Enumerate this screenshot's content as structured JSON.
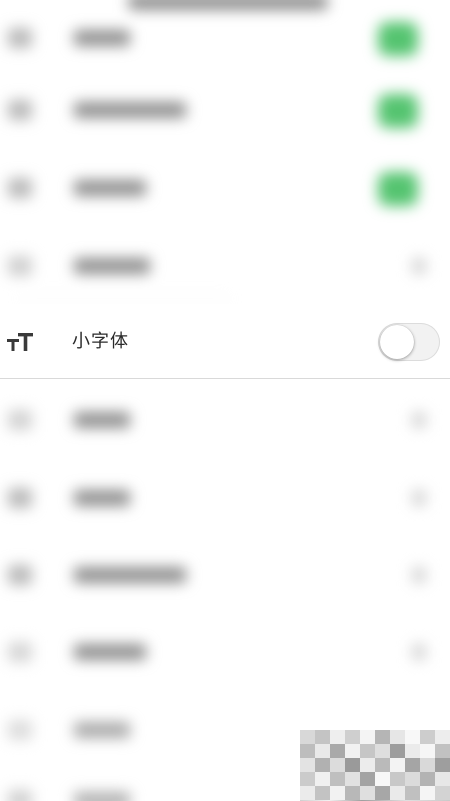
{
  "setting": {
    "label": "小字体",
    "enabled": false
  },
  "icons": {
    "setting_icon": "small-font-icon"
  },
  "colors": {
    "toggle_on": "#55c470",
    "toggle_off_track": "#f2f2f2",
    "text": "#2a2a2a"
  }
}
